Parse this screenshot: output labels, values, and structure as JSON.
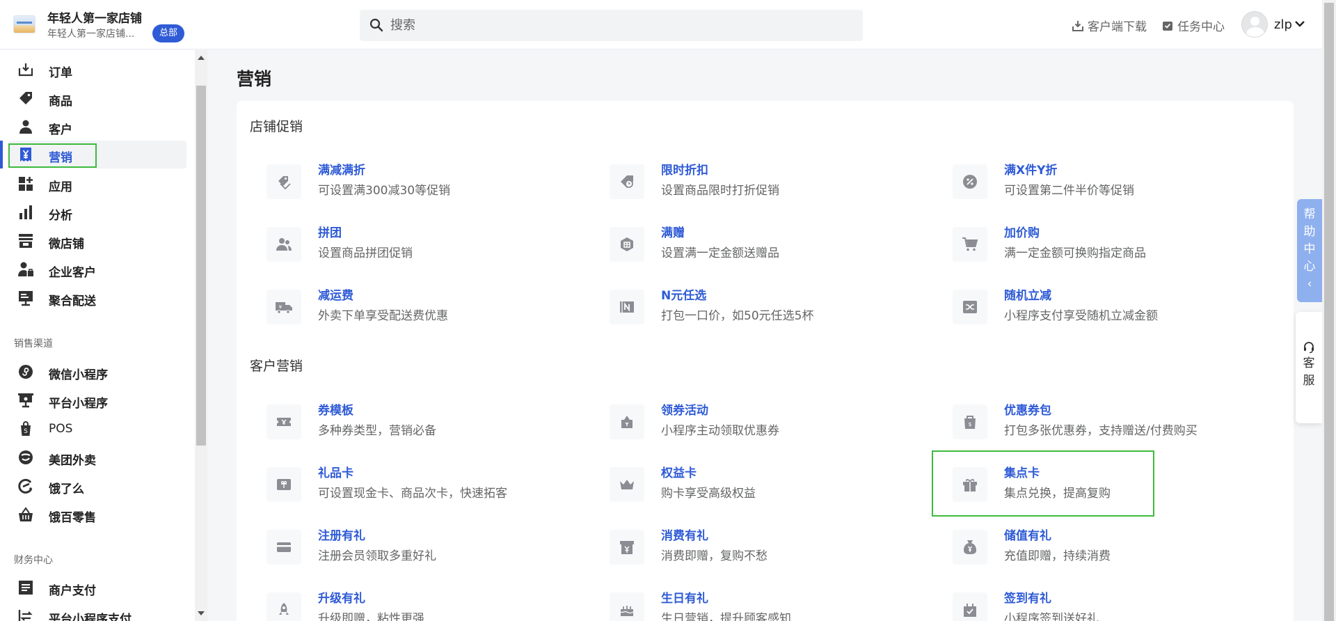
{
  "header": {
    "store_name": "年轻人第一家店铺",
    "store_sub": "年轻人第一家店铺...",
    "hq_badge": "总部",
    "search_placeholder": "搜索",
    "download_label": "客户端下载",
    "task_label": "任务中心",
    "username": "zlp"
  },
  "sidebar": {
    "main_items": [
      {
        "label": "订单",
        "icon": "download-tray-icon"
      },
      {
        "label": "商品",
        "icon": "tag-icon"
      },
      {
        "label": "客户",
        "icon": "user-icon"
      },
      {
        "label": "营销",
        "icon": "yen-ticket-icon",
        "active": true
      },
      {
        "label": "应用",
        "icon": "apps-grid-icon"
      },
      {
        "label": "分析",
        "icon": "bar-chart-icon"
      },
      {
        "label": "微店铺",
        "icon": "storefront-icon"
      },
      {
        "label": "企业客户",
        "icon": "enterprise-user-icon"
      },
      {
        "label": "聚合配送",
        "icon": "monitor-icon"
      }
    ],
    "sales_title": "销售渠道",
    "sales_items": [
      {
        "label": "微信小程序",
        "icon": "mini-program-icon"
      },
      {
        "label": "平台小程序",
        "icon": "platform-icon"
      },
      {
        "label": "POS",
        "icon": "pos-bag-icon"
      },
      {
        "label": "美团外卖",
        "icon": "meituan-icon"
      },
      {
        "label": "饿了么",
        "icon": "eleme-icon"
      },
      {
        "label": "饿百零售",
        "icon": "basket-icon"
      }
    ],
    "finance_title": "财务中心",
    "finance_items": [
      {
        "label": "商户支付",
        "icon": "document-icon"
      },
      {
        "label": "平台小程序支付",
        "icon": "transfer-icon"
      }
    ]
  },
  "main": {
    "page_title": "营销",
    "sections": [
      {
        "title": "店铺促销",
        "features": [
          {
            "name": "满减满折",
            "desc": "可设置满300减30等促销",
            "icon": "tags-icon"
          },
          {
            "name": "限时折扣",
            "desc": "设置商品限时打折促销",
            "icon": "clock-tag-icon"
          },
          {
            "name": "满X件Y折",
            "desc": "可设置第二件半价等促销",
            "icon": "percent-badge-icon"
          },
          {
            "name": "拼团",
            "desc": "设置商品拼团促销",
            "icon": "group-users-icon"
          },
          {
            "name": "满赠",
            "desc": "设置满一定金额送赠品",
            "icon": "gift-hexagon-icon"
          },
          {
            "name": "加价购",
            "desc": "满一定金额可换购指定商品",
            "icon": "cart-icon"
          },
          {
            "name": "减运费",
            "desc": "外卖下单享受配送费优惠",
            "icon": "truck-icon"
          },
          {
            "name": "N元任选",
            "desc": "打包一口价，如50元任选5杯",
            "icon": "n-box-icon"
          },
          {
            "name": "随机立减",
            "desc": "小程序支付享受随机立减金额",
            "icon": "shuffle-icon"
          }
        ]
      },
      {
        "title": "客户营销",
        "features": [
          {
            "name": "券模板",
            "desc": "多种券类型，营销必备",
            "icon": "coupon-icon"
          },
          {
            "name": "领券活动",
            "desc": "小程序主动领取优惠券",
            "icon": "coupon-bag-icon"
          },
          {
            "name": "优惠券包",
            "desc": "打包多张优惠券，支持赠送/付费购买",
            "icon": "money-bag-icon"
          },
          {
            "name": "礼品卡",
            "desc": "可设置现金卡、商品次卡，快速拓客",
            "icon": "gift-card-icon"
          },
          {
            "name": "权益卡",
            "desc": "购卡享受高级权益",
            "icon": "crown-icon"
          },
          {
            "name": "集点卡",
            "desc": "集点兑换，提高复购",
            "icon": "gift-box-icon",
            "highlighted": true
          },
          {
            "name": "注册有礼",
            "desc": "注册会员领取多重好礼",
            "icon": "card-icon"
          },
          {
            "name": "消费有礼",
            "desc": "消费即赠，复购不愁",
            "icon": "yen-box-icon"
          },
          {
            "name": "储值有礼",
            "desc": "充值即赠，持续消费",
            "icon": "yen-bag-icon"
          },
          {
            "name": "升级有礼",
            "desc": "升级即赠，粘性更强",
            "icon": "rocket-icon"
          },
          {
            "name": "生日有礼",
            "desc": "生日营销，提升顾客感知",
            "icon": "cake-icon"
          },
          {
            "name": "签到有礼",
            "desc": "小程序签到送好礼",
            "icon": "checkin-bag-icon"
          }
        ]
      }
    ]
  },
  "widgets": {
    "help_chars": [
      "帮",
      "助",
      "中",
      "心",
      "‹"
    ],
    "service_chars": [
      "客",
      "服"
    ]
  },
  "colors": {
    "accent": "#2f5bd6",
    "highlight": "#3dbb3d",
    "help_tab": "#8fb0ee"
  }
}
